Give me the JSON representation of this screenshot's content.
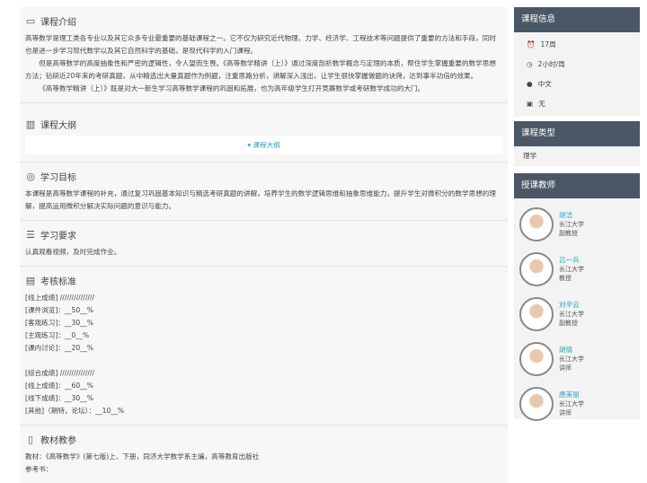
{
  "intro": {
    "title": "课程介绍",
    "paragraphs": [
      "高等数学是理工类各专业以及其它众多专业最重要的基础课程之一。它不仅为研究近代物理、力学、经济学、工程技术等问题提供了重要的方法和手段，同时也是进一步学习现代数学以及其它自然科学的基础，是现代科学的入门课程。",
      "但是高等数学的高度抽象性和严密的逻辑性，令人望而生畏。《高等数学精讲（上）》通过深度剖析数学概念与定理的本质，帮住学生掌握重要的数学思想方法；钻研近20年来的考研真题，从中精选出大量真题作为例题，注重思路分析，讲解深入浅出，让学生很快掌握做题的诀窍，达到事半功倍的效果。",
      "《高等数学精讲（上）》既是对大一新生学习高等数学课程的巩固和拓展，也为高年级学生打开竞赛数学或考研数学成功的大门。"
    ]
  },
  "outline": {
    "title": "课程大纲",
    "toggle": "课程大纲"
  },
  "goals": {
    "title": "学习目标",
    "text": "本课程是高等数学课程的补充，通过复习巩固基本知识与精选考研真题的讲解，培养学生的数学逻辑思维和抽象思维能力，提升学生对微积分的数学思想的理解，提高运用微积分解决实际问题的意识与能力。"
  },
  "requirements": {
    "title": "学习要求",
    "text": "认真观看视频，及时完成作业。"
  },
  "assessment": {
    "title": "考核标准",
    "lines": [
      "[线上成绩] ///////////////",
      "[课件浏览]：__50__%",
      "[客观练习]：__30__%",
      "[主观练习]：__0__%",
      "[课内讨论]：__20__%",
      "",
      "[综合成绩] ///////////////",
      "[线上成绩]：__60__%",
      "[线下成绩]：__30__%",
      "[其他]（期特，论坛）：__10__%"
    ]
  },
  "textbooks": {
    "title": "教材教参",
    "lines": [
      "教材：《高等数学》(第七版)上、下册，同济大学数学系主编，高等教育出版社",
      "参考书："
    ]
  },
  "course_info": {
    "title": "课程信息",
    "weeks": "17周",
    "hours": "2小时/周",
    "language": "中文",
    "extra": "无"
  },
  "course_type": {
    "title": "课程类型",
    "value": "理学"
  },
  "teachers": {
    "title": "授课教师",
    "list": [
      {
        "name": "胡洁",
        "school": "长江大学",
        "rank": "副教授"
      },
      {
        "name": "吕一兵",
        "school": "长江大学",
        "rank": "教授"
      },
      {
        "name": "刘辛云",
        "school": "长江大学",
        "rank": "副教授"
      },
      {
        "name": "胡倩",
        "school": "长江大学",
        "rank": "讲师"
      },
      {
        "name": "唐美丽",
        "school": "长江大学",
        "rank": "讲师"
      }
    ]
  }
}
